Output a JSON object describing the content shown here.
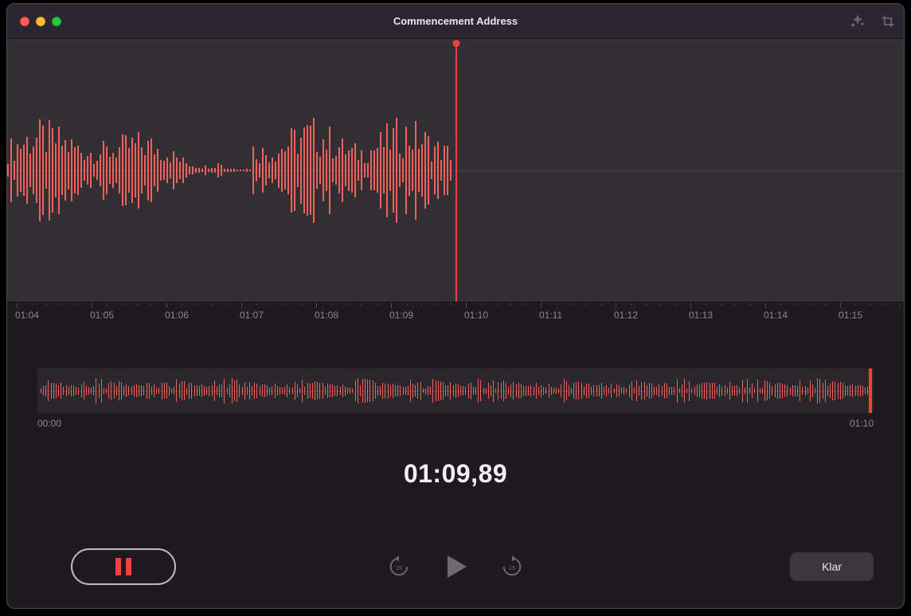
{
  "window": {
    "title": "Commencement Address"
  },
  "ruler": {
    "labels": [
      "01:04",
      "01:05",
      "01:06",
      "01:07",
      "01:08",
      "01:09",
      "01:10",
      "01:11",
      "01:12",
      "01:13",
      "01:14",
      "01:15"
    ]
  },
  "overview": {
    "start_label": "00:00",
    "end_label": "01:10"
  },
  "timer": {
    "value": "01:09,89"
  },
  "controls": {
    "done_label": "Klar"
  },
  "waveform": {
    "playhead_percent": 50,
    "main_bar_count": 140,
    "mini_bar_count": 330
  },
  "icons": {
    "sparkle": "sparkle-icon",
    "crop": "crop-icon",
    "skip_back": "skip-back-15-icon",
    "play": "play-icon",
    "skip_fwd": "skip-forward-15-icon",
    "pause": "pause-icon"
  },
  "colors": {
    "accent": "#f0413c",
    "wave": "#f0615d",
    "bg_dark": "#1d1b1f",
    "bg_panel": "#322f35"
  }
}
